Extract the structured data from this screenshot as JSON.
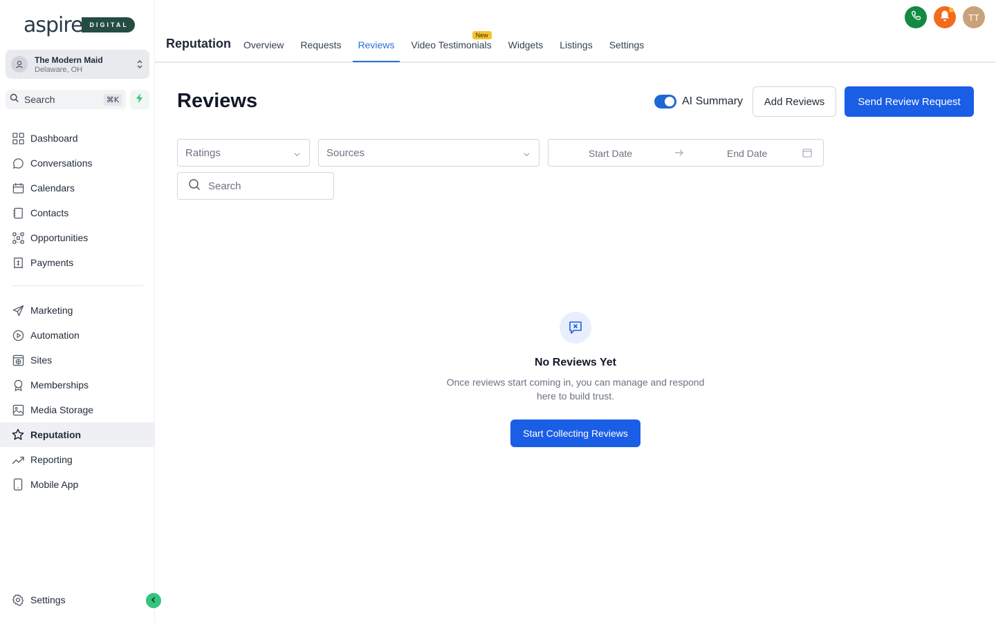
{
  "brand": {
    "logo_word": "aspire",
    "logo_tag": "DIGITAL",
    "accent": "#1a5ee5",
    "green": "#244c43"
  },
  "account": {
    "name": "The Modern Maid",
    "location": "Delaware, OH"
  },
  "sidebar": {
    "search_label": "Search",
    "search_shortcut": "⌘K",
    "items_top": [
      {
        "label": "Dashboard",
        "icon": "grid-icon"
      },
      {
        "label": "Conversations",
        "icon": "chat-icon"
      },
      {
        "label": "Calendars",
        "icon": "calendar-icon"
      },
      {
        "label": "Contacts",
        "icon": "contacts-icon"
      },
      {
        "label": "Opportunities",
        "icon": "network-icon"
      },
      {
        "label": "Payments",
        "icon": "receipt-icon"
      }
    ],
    "items_bottom": [
      {
        "label": "Marketing",
        "icon": "send-icon"
      },
      {
        "label": "Automation",
        "icon": "automation-icon"
      },
      {
        "label": "Sites",
        "icon": "globe-icon"
      },
      {
        "label": "Memberships",
        "icon": "award-icon"
      },
      {
        "label": "Media Storage",
        "icon": "image-icon"
      },
      {
        "label": "Reputation",
        "icon": "star-icon",
        "active": true
      },
      {
        "label": "Reporting",
        "icon": "trend-icon"
      },
      {
        "label": "Mobile App",
        "icon": "phone-icon"
      }
    ],
    "settings_label": "Settings"
  },
  "header": {
    "section_title": "Reputation",
    "tabs": [
      {
        "label": "Overview"
      },
      {
        "label": "Requests"
      },
      {
        "label": "Reviews",
        "active": true
      },
      {
        "label": "Video Testimonials",
        "badge": "New"
      },
      {
        "label": "Widgets"
      },
      {
        "label": "Listings"
      },
      {
        "label": "Settings"
      }
    ],
    "avatar_initials": "TT"
  },
  "main": {
    "title": "Reviews",
    "ai_summary_label": "AI Summary",
    "ai_summary_on": true,
    "add_reviews_label": "Add Reviews",
    "send_request_label": "Send Review Request",
    "filters": {
      "ratings_placeholder": "Ratings",
      "sources_placeholder": "Sources",
      "start_date_placeholder": "Start Date",
      "end_date_placeholder": "End Date",
      "search_placeholder": "Search"
    },
    "empty": {
      "title": "No Reviews Yet",
      "description": "Once reviews start coming in, you can manage and respond here to build trust.",
      "cta_label": "Start Collecting Reviews"
    }
  }
}
